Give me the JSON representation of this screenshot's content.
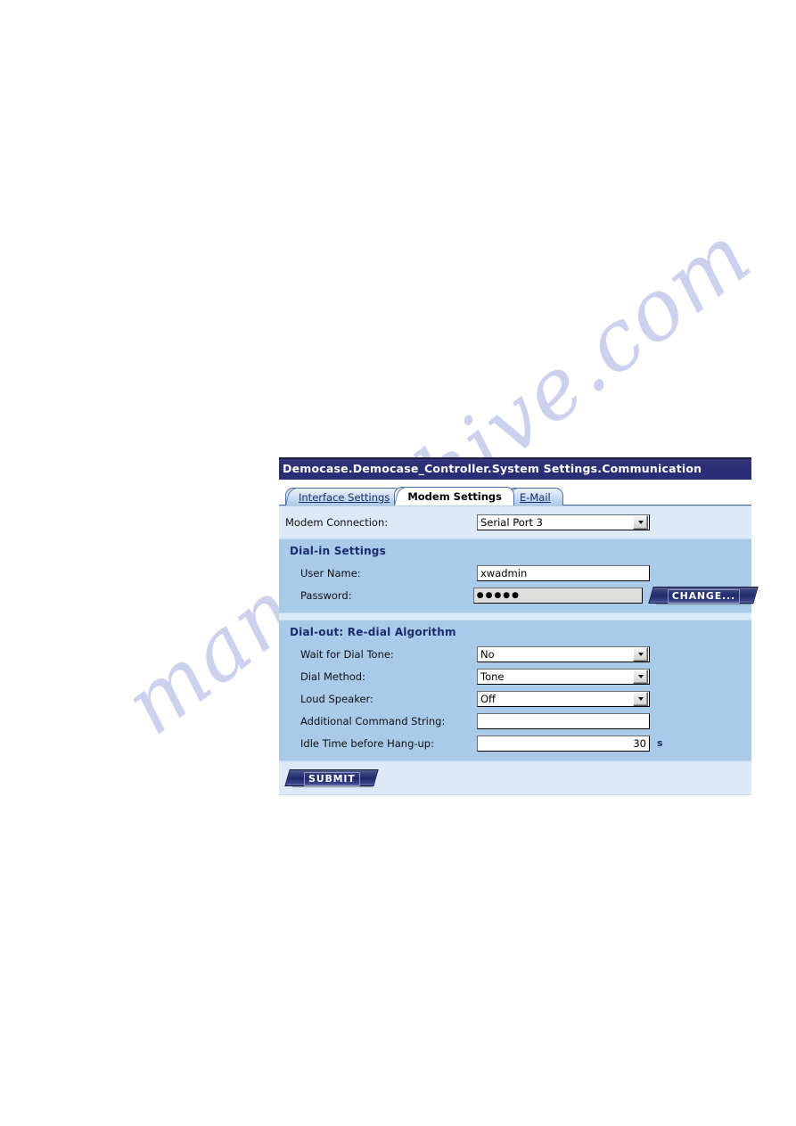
{
  "watermark": {
    "text": "manualshive.com"
  },
  "window": {
    "title": "Democase.Democase_Controller.System Settings.Communication"
  },
  "tabs": [
    {
      "id": "interface-settings",
      "label": "Interface Settings",
      "active": false
    },
    {
      "id": "modem-settings",
      "label": "Modem Settings",
      "active": true
    },
    {
      "id": "e-mail",
      "label": "E-Mail",
      "active": false
    }
  ],
  "form": {
    "modem_connection": {
      "label": "Modem Connection:",
      "value": "Serial Port 3"
    },
    "dial_in": {
      "title": "Dial-in Settings",
      "user_name": {
        "label": "User Name:",
        "value": "xwadmin"
      },
      "password": {
        "label": "Password:",
        "value": "●●●●●"
      },
      "change_button": "CHANGE..."
    },
    "dial_out": {
      "title": "Dial-out: Re-dial Algorithm",
      "wait_for_dial_tone": {
        "label": "Wait for Dial Tone:",
        "value": "No"
      },
      "dial_method": {
        "label": "Dial Method:",
        "value": "Tone"
      },
      "loud_speaker": {
        "label": "Loud Speaker:",
        "value": "Off"
      },
      "additional_command_string": {
        "label": "Additional Command String:",
        "value": ""
      },
      "idle_time": {
        "label": "Idle Time before Hang-up:",
        "value": "30",
        "unit": "s"
      }
    },
    "submit_button": "SUBMIT"
  },
  "colors": {
    "title_bar": "#2a2e78",
    "group_box": "#a9cae9",
    "form_background": "#dce9f7",
    "accent_text": "#1c2a6e",
    "button_face": "#212b6b"
  }
}
